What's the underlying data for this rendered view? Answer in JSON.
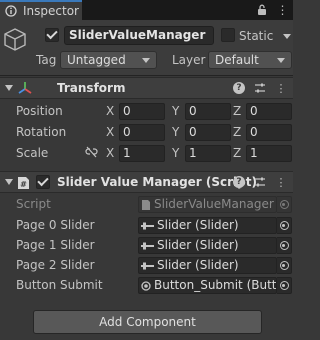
{
  "tab": {
    "title": "Inspector",
    "icon": "info-icon"
  },
  "tab_actions": [
    {
      "icon": "lock-icon"
    },
    {
      "icon": "more-icon"
    }
  ],
  "gameobject": {
    "icon": "cube-icon",
    "active": true,
    "name": "SliderValueManager",
    "static_label": "Static",
    "static_checked": false,
    "tag_label": "Tag",
    "tag_value": "Untagged",
    "layer_label": "Layer",
    "layer_value": "Default"
  },
  "transform": {
    "title": "Transform",
    "icon": "transform-icon",
    "rows": [
      {
        "label": "Position",
        "x": "0",
        "y": "0",
        "z": "0"
      },
      {
        "label": "Rotation",
        "x": "0",
        "y": "0",
        "z": "0"
      },
      {
        "label": "Scale",
        "x": "1",
        "y": "1",
        "z": "1"
      }
    ],
    "axis_labels": {
      "x": "X",
      "y": "Y",
      "z": "Z"
    }
  },
  "script_component": {
    "title": "Slider Value Manager (Script)",
    "icon": "csharp-script-icon",
    "enabled": true,
    "fields": [
      {
        "label": "Script",
        "value": "SliderValueManager",
        "icon": "script-file-icon",
        "disabled": true
      },
      {
        "label": "Page 0 Slider",
        "value": "Slider (Slider)",
        "icon": "slider-icon",
        "disabled": false
      },
      {
        "label": "Page 1 Slider",
        "value": "Slider (Slider)",
        "icon": "slider-icon",
        "disabled": false
      },
      {
        "label": "Page 2 Slider",
        "value": "Slider (Slider)",
        "icon": "slider-icon",
        "disabled": false
      },
      {
        "label": "Button Submit",
        "value": "Button_Submit (Butto",
        "icon": "button-component-icon",
        "disabled": false
      }
    ]
  },
  "add_component_label": "Add Component"
}
